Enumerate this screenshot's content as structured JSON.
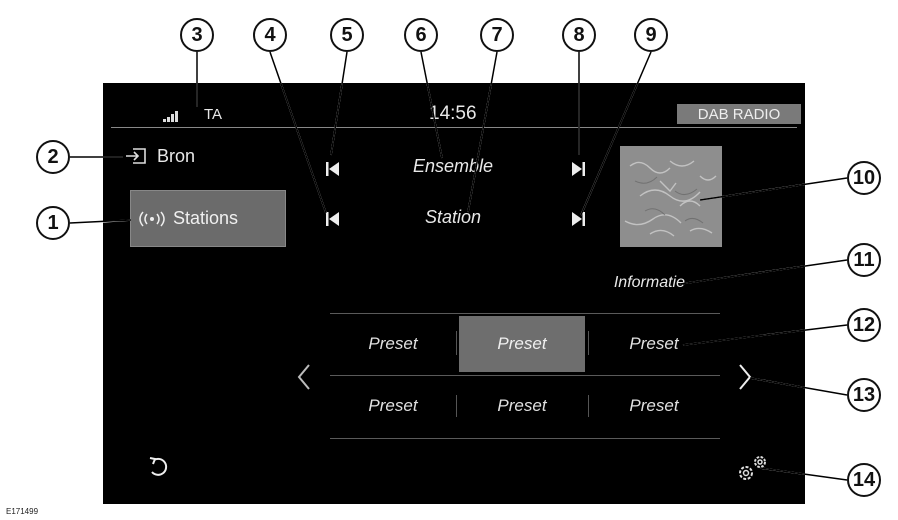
{
  "callouts": [
    "1",
    "2",
    "3",
    "4",
    "5",
    "6",
    "7",
    "8",
    "9",
    "10",
    "11",
    "12",
    "13",
    "14"
  ],
  "status": {
    "ta": "TA",
    "time": "14:56",
    "mode_badge": "DAB RADIO"
  },
  "source": {
    "label": "Bron",
    "icon": "source-input-icon"
  },
  "stations": {
    "label": "Stations",
    "icon": "broadcast-waves-icon"
  },
  "now_playing": {
    "ensemble": "Ensemble",
    "station": "Station",
    "info": "Informatie"
  },
  "presets": [
    [
      {
        "label": "Preset",
        "selected": false
      },
      {
        "label": "Preset",
        "selected": true
      },
      {
        "label": "Preset",
        "selected": false
      }
    ],
    [
      {
        "label": "Preset",
        "selected": false
      },
      {
        "label": "Preset",
        "selected": false
      },
      {
        "label": "Preset",
        "selected": false
      }
    ]
  ],
  "icons": {
    "back": "back-arrow-icon",
    "settings": "settings-gears-icon",
    "prev": "chevron-left-icon",
    "next": "chevron-right-icon"
  },
  "figure_id": "E171499"
}
